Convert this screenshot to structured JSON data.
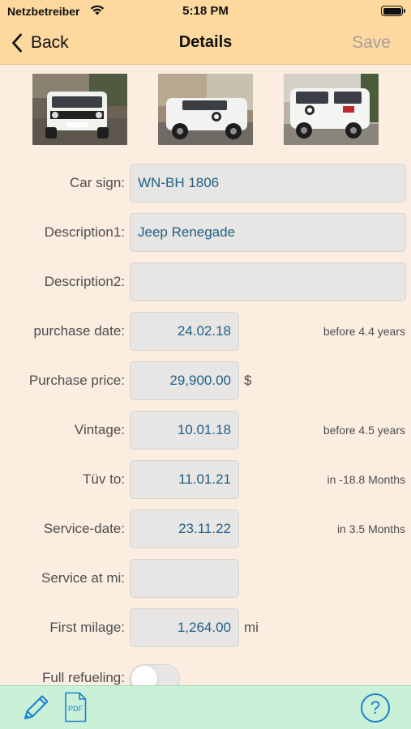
{
  "status_bar": {
    "carrier": "Netzbetreiber",
    "time": "5:18 PM",
    "wifi_icon": "wifi-icon",
    "battery_icon": "battery-icon"
  },
  "nav": {
    "back_label": "Back",
    "title": "Details",
    "save_label": "Save"
  },
  "photos": [
    {
      "name": "car-photo-1",
      "description": "white jeep front"
    },
    {
      "name": "car-photo-2",
      "description": "white jeep side"
    },
    {
      "name": "car-photo-3",
      "description": "white jeep rear"
    }
  ],
  "form": {
    "car_sign": {
      "label": "Car sign:",
      "value": "WN-BH 1806"
    },
    "description1": {
      "label": "Description1:",
      "value": "Jeep Renegade"
    },
    "description2": {
      "label": "Description2:",
      "value": ""
    },
    "purchase_date": {
      "label": "purchase date:",
      "value": "24.02.18",
      "note": "before 4.4 years"
    },
    "purchase_price": {
      "label": "Purchase price:",
      "value": "29,900.00",
      "unit": "$"
    },
    "vintage": {
      "label": "Vintage:",
      "value": "10.01.18",
      "note": "before 4.5 years"
    },
    "tuv_to": {
      "label": "Tüv to:",
      "value": "11.01.21",
      "note": "in -18.8 Months"
    },
    "service_date": {
      "label": "Service-date:",
      "value": "23.11.22",
      "note": "in 3.5 Months"
    },
    "service_at_mi": {
      "label": "Service at mi:",
      "value": ""
    },
    "first_milage": {
      "label": "First milage:",
      "value": "1,264.00",
      "unit": "mi"
    },
    "full_refueling": {
      "label": "Full refueling:",
      "on": false
    }
  },
  "toolbar": {
    "edit_icon": "pencil-icon",
    "pdf_icon": "pdf-icon",
    "pdf_text": "PDF",
    "help_icon": "help-icon",
    "help_text": "?"
  },
  "colors": {
    "nav_background": "#fdd9a0",
    "page_background": "#fbeee1",
    "toolbar_background": "#c9f1d8",
    "value_text": "#1f5f86",
    "accent_blue": "#1d7fd0"
  }
}
